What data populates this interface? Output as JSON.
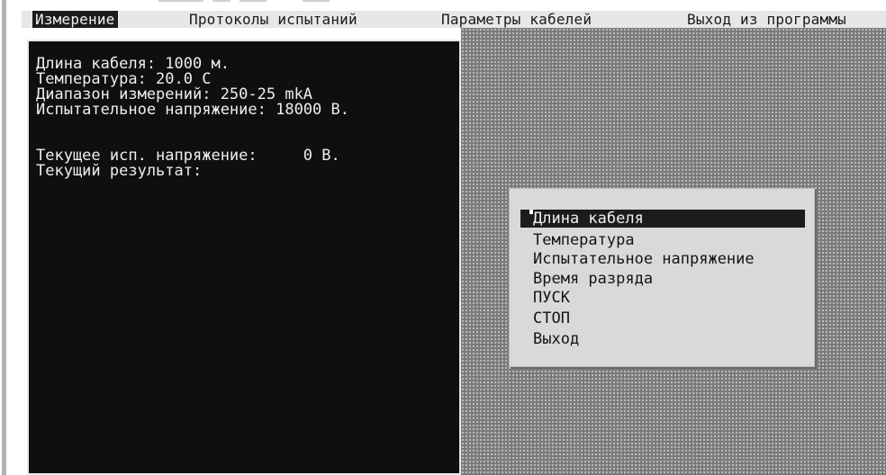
{
  "menubar": {
    "items": [
      {
        "label": "Измерение",
        "active": true
      },
      {
        "label": "Протоколы испытаний",
        "active": false
      },
      {
        "label": "Параметры кабелей",
        "active": false
      },
      {
        "label": "Выход из программы",
        "active": false
      }
    ]
  },
  "status_panel": {
    "cable_length": "Длина кабеля: 1000 м.",
    "temperature": "Температура: 20.0 С",
    "range": "Диапазон измерений: 250-25 mkA",
    "test_voltage": "Испытательное напряжение: 18000 В.",
    "current_voltage": "Текущее исп. напряжение:     0 В.",
    "current_result": "Текущий результат:"
  },
  "popup_menu": {
    "options": [
      {
        "label": "Длина кабеля",
        "selected": true
      },
      {
        "label": "Температура",
        "selected": false
      },
      {
        "label": "Испытательное напряжение",
        "selected": false
      },
      {
        "label": "Время разряда",
        "selected": false
      },
      {
        "label": "ПУСК",
        "selected": false
      },
      {
        "label": "СТОП",
        "selected": false
      },
      {
        "label": "Выход",
        "selected": false
      }
    ]
  },
  "colors": {
    "menubar_bg": "#e7e7e7",
    "panel_bg": "#0f0f0f",
    "panel_text": "#eeeeee",
    "popup_bg": "#d9d9d9",
    "highlight_bg": "#1c1c1c",
    "desktop_bg": "#7b7b7b"
  }
}
